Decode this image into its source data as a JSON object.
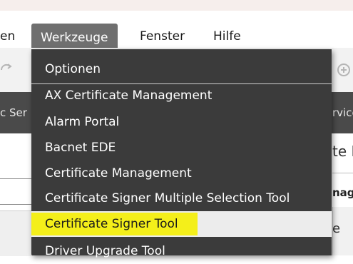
{
  "menubar": {
    "items": [
      {
        "label": "en"
      },
      {
        "label": "Werkzeuge"
      },
      {
        "label": "Fenster"
      },
      {
        "label": "Hilfe"
      }
    ]
  },
  "background": {
    "tab_left": "c  Ser",
    "tab_right": "rvice",
    "right_title": "te M",
    "right_label": "nag",
    "right_field_text": "e"
  },
  "dropdown": {
    "items": [
      {
        "label": "Optionen"
      },
      {
        "label": "AX Certificate Management"
      },
      {
        "label": "Alarm Portal"
      },
      {
        "label": "Bacnet EDE"
      },
      {
        "label": "Certificate Management"
      },
      {
        "label": "Certificate Signer Multiple Selection Tool"
      },
      {
        "label": "Certificate Signer Tool"
      },
      {
        "label": "Driver Upgrade Tool"
      }
    ],
    "selected_index": 6,
    "highlight_color": "#f4ef1a"
  },
  "colors": {
    "menu_active_bg": "#6f6f6f",
    "dropdown_bg": "#3b3b3b",
    "tabbar_bg": "#4a4a4a"
  }
}
